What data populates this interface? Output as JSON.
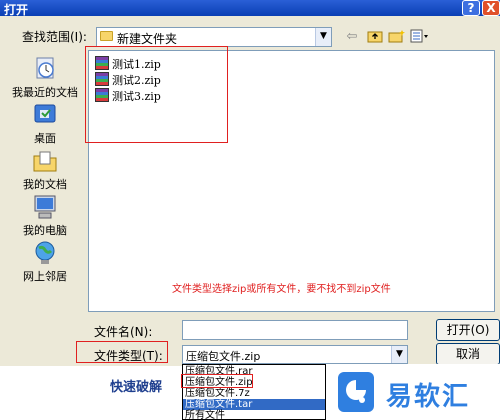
{
  "window": {
    "title": "打开",
    "help_label": "?",
    "close_label": "X"
  },
  "look_in": {
    "label": "查找范围(I):",
    "value": "新建文件夹"
  },
  "toolbar": {
    "back_icon": "back-arrow-icon",
    "up_icon": "up-folder-icon",
    "new_folder_icon": "new-folder-icon",
    "view_icon": "view-menu-icon"
  },
  "places": [
    {
      "label": "我最近的文档",
      "icon": "recent-documents-icon"
    },
    {
      "label": "桌面",
      "icon": "desktop-icon"
    },
    {
      "label": "我的文档",
      "icon": "my-documents-icon"
    },
    {
      "label": "我的电脑",
      "icon": "my-computer-icon"
    },
    {
      "label": "网上邻居",
      "icon": "network-icon"
    }
  ],
  "files": [
    {
      "name": "测试1.zip"
    },
    {
      "name": "测试2.zip"
    },
    {
      "name": "测试3.zip"
    }
  ],
  "annotation": "文件类型选择zip或所有文件，要不找不到zip文件",
  "file_name": {
    "label": "文件名(N):",
    "value": ""
  },
  "file_type": {
    "label": "文件类型(T):",
    "value": "压缩包文件.zip"
  },
  "buttons": {
    "open": "打开(O)",
    "cancel": "取消"
  },
  "file_type_options": [
    {
      "label": "压缩包文件.rar",
      "selected": false
    },
    {
      "label": "压缩包文件.zip",
      "selected": false
    },
    {
      "label": "压缩包文件.7z",
      "selected": false
    },
    {
      "label": "压缩包文件.tar",
      "selected": true
    },
    {
      "label": "所有文件",
      "selected": false
    }
  ],
  "background_app": {
    "quick_crack": "快速破解"
  },
  "watermark": {
    "text": "易软汇"
  },
  "colors": {
    "titlebar": "#0a3fb4",
    "dialog_bg": "#ece9d8",
    "annotation": "#e02020",
    "selection": "#316ac5",
    "watermark": "#2f7fe0"
  }
}
